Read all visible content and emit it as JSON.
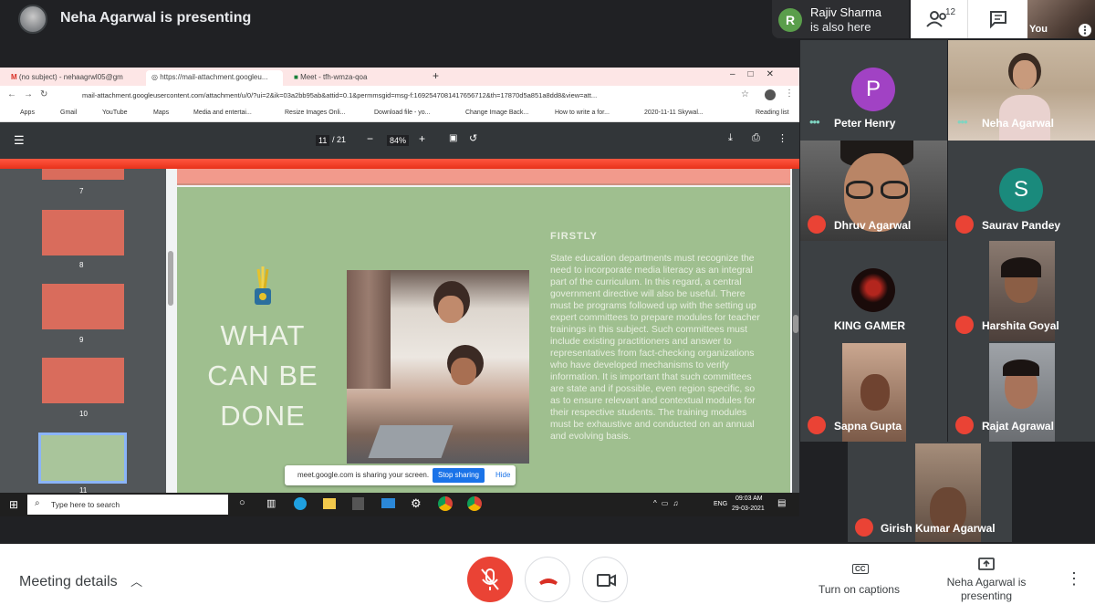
{
  "topbar": {
    "presenting_title": "Neha Agarwal is presenting",
    "also_here": {
      "initial": "R",
      "name": "Rajiv Sharma",
      "status": "is also here"
    },
    "people_count": "12",
    "you_label": "You"
  },
  "browser": {
    "tabs": [
      {
        "title": "(no subject) - nehaagrwl05@gm",
        "icon": "gmail-icon"
      },
      {
        "title": "https://mail-attachment.googleu...",
        "icon": "globe-icon"
      },
      {
        "title": "Meet - tfh-wmza-qoa",
        "icon": "meet-icon"
      }
    ],
    "url": "mail-attachment.googleusercontent.com/attachment/u/0/?ui=2&ik=03a2bb95ab&attid=0.1&permmsgid=msg-f:1692547081417656712&th=17870d5a851a8dd8&view=att...",
    "bookmarks": [
      "Apps",
      "Gmail",
      "YouTube",
      "Maps",
      "Media and entertai...",
      "Resize Images Onli...",
      "Download file - yo...",
      "Change Image Back...",
      "How to write a for...",
      "2020-11-11 Skywal...",
      "Reading list"
    ],
    "pdf": {
      "page": "11",
      "total": "/ 21",
      "zoom": "84%"
    },
    "thumb_numbers": [
      "7",
      "8",
      "9",
      "10",
      "11"
    ]
  },
  "slide": {
    "heading": "WHAT CAN BE DONE",
    "section": "FIRSTLY",
    "body": "State education departments must recognize the need to incorporate media literacy as an integral part of the curriculum. In this regard, a central government directive will also be useful. There must be programs followed up with the setting up expert committees to prepare modules for teacher trainings in this subject. Such committees must include existing practitioners and answer to representatives from fact-checking organizations who have developed mechanisms to verify information. It is important that such committees are state and if possible, even region specific, so as to ensure relevant and contextual modules for their respective students. The training modules must be exhaustive and conducted on an annual and evolving basis."
  },
  "sharebar": {
    "message": "meet.google.com is sharing your screen.",
    "stop": "Stop sharing",
    "hide": "Hide"
  },
  "taskbar": {
    "search_placeholder": "Type here to search",
    "lang": "ENG",
    "time": "09:03 AM",
    "date": "29-03-2021"
  },
  "participants": [
    {
      "name": "Peter Henry",
      "initial": "P",
      "color": "#a142c4",
      "speaking": true
    },
    {
      "name": "Neha Agarwal",
      "speaking": true
    },
    {
      "name": "Dhruv Agarwal",
      "muted": true
    },
    {
      "name": "Saurav Pandey",
      "initial": "S",
      "color": "#1a8a7c",
      "muted": true
    },
    {
      "name": "KING GAMER"
    },
    {
      "name": "Harshita Goyal",
      "muted": true
    },
    {
      "name": "Sapna Gupta",
      "muted": true
    },
    {
      "name": "Rajat Agrawal",
      "muted": true
    },
    {
      "name": "Girish Kumar Agarwal",
      "muted": true
    }
  ],
  "bottombar": {
    "meeting_details": "Meeting details",
    "captions": "Turn on captions",
    "captions_icon": "CC",
    "presenting": "Neha Agarwal is presenting"
  }
}
